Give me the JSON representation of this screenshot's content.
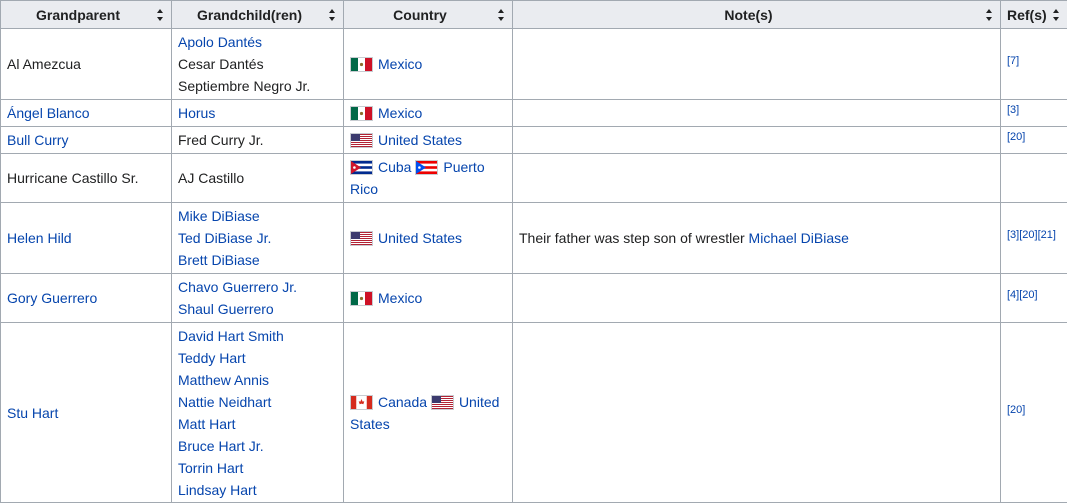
{
  "headers": [
    "Grandparent",
    "Grandchild(ren)",
    "Country",
    "Note(s)",
    "Ref(s)"
  ],
  "rows": [
    {
      "grandparent": {
        "text": "Al Amezcua",
        "link": false
      },
      "grandchildren": [
        {
          "text": "Apolo Dantés",
          "link": true
        },
        {
          "text": "Cesar Dantés",
          "link": false
        },
        {
          "text": "Septiembre Negro Jr.",
          "link": false
        }
      ],
      "countries": [
        {
          "flag": "mexico",
          "name": "Mexico"
        }
      ],
      "note": [],
      "refs": [
        "[7]"
      ]
    },
    {
      "grandparent": {
        "text": "Ángel Blanco",
        "link": true
      },
      "grandchildren": [
        {
          "text": "Horus",
          "link": true
        }
      ],
      "countries": [
        {
          "flag": "mexico",
          "name": "Mexico"
        }
      ],
      "note": [],
      "refs": [
        "[3]"
      ]
    },
    {
      "grandparent": {
        "text": "Bull Curry",
        "link": true
      },
      "grandchildren": [
        {
          "text": "Fred Curry Jr.",
          "link": false
        }
      ],
      "countries": [
        {
          "flag": "usa",
          "name": "United States"
        }
      ],
      "note": [],
      "refs": [
        "[20]"
      ]
    },
    {
      "grandparent": {
        "text": "Hurricane Castillo Sr.",
        "link": false
      },
      "grandchildren": [
        {
          "text": "AJ Castillo",
          "link": false
        }
      ],
      "countries": [
        {
          "flag": "cuba",
          "name": "Cuba"
        },
        {
          "flag": "puerto-rico",
          "name": "Puerto Rico"
        }
      ],
      "note": [],
      "refs": []
    },
    {
      "grandparent": {
        "text": "Helen Hild",
        "link": true
      },
      "grandchildren": [
        {
          "text": "Mike DiBiase",
          "link": true
        },
        {
          "text": "Ted DiBiase Jr.",
          "link": true
        },
        {
          "text": "Brett DiBiase",
          "link": true
        }
      ],
      "countries": [
        {
          "flag": "usa",
          "name": "United States"
        }
      ],
      "note": [
        {
          "text": "Their father was step son of wrestler ",
          "link": false
        },
        {
          "text": "Michael DiBiase",
          "link": true
        }
      ],
      "refs": [
        "[3]",
        "[20]",
        "[21]"
      ]
    },
    {
      "grandparent": {
        "text": "Gory Guerrero",
        "link": true
      },
      "grandchildren": [
        {
          "text": "Chavo Guerrero Jr.",
          "link": true
        },
        {
          "text": "Shaul Guerrero",
          "link": true
        }
      ],
      "countries": [
        {
          "flag": "mexico",
          "name": "Mexico"
        }
      ],
      "note": [],
      "refs": [
        "[4]",
        "[20]"
      ]
    },
    {
      "grandparent": {
        "text": "Stu Hart",
        "link": true
      },
      "grandchildren": [
        {
          "text": "David Hart Smith",
          "link": true
        },
        {
          "text": "Teddy Hart",
          "link": true
        },
        {
          "text": "Matthew Annis",
          "link": true
        },
        {
          "text": "Nattie Neidhart",
          "link": true
        },
        {
          "text": "Matt Hart",
          "link": true
        },
        {
          "text": "Bruce Hart Jr.",
          "link": true
        },
        {
          "text": "Torrin Hart",
          "link": true
        },
        {
          "text": "Lindsay Hart",
          "link": true
        }
      ],
      "countries": [
        {
          "flag": "canada",
          "name": "Canada"
        },
        {
          "flag": "usa",
          "name": "United States"
        }
      ],
      "note": [],
      "refs": [
        "[20]"
      ]
    }
  ]
}
